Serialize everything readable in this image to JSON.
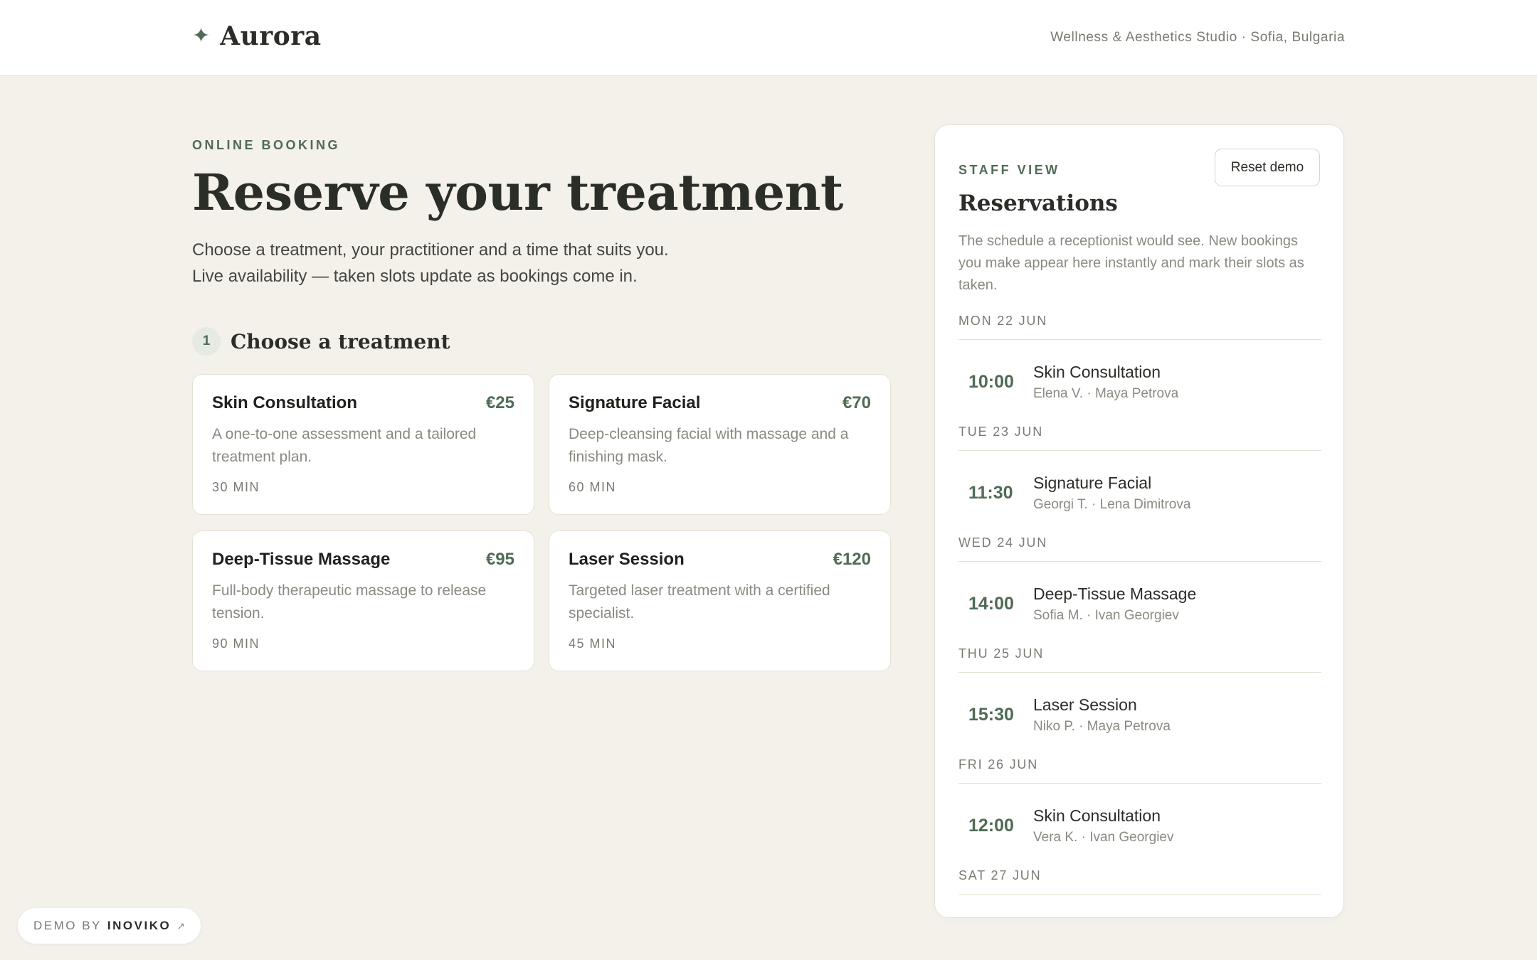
{
  "header": {
    "brand_icon": "✦",
    "brand_name": "Aurora",
    "tagline": "Wellness & Aesthetics Studio · Sofia, Bulgaria"
  },
  "hero": {
    "eyebrow": "ONLINE BOOKING",
    "title": "Reserve your treatment",
    "subtitle_line1": "Choose a treatment, your practitioner and a time that suits you.",
    "subtitle_line2": "Live availability — taken slots update as bookings come in."
  },
  "step": {
    "number": "1",
    "title": "Choose a treatment"
  },
  "treatments": [
    {
      "name": "Skin Consultation",
      "price": "€25",
      "description": "A one-to-one assessment and a tailored treatment plan.",
      "duration": "30 MIN"
    },
    {
      "name": "Signature Facial",
      "price": "€70",
      "description": "Deep-cleansing facial with massage and a finishing mask.",
      "duration": "60 MIN"
    },
    {
      "name": "Deep-Tissue Massage",
      "price": "€95",
      "description": "Full-body therapeutic massage to release tension.",
      "duration": "90 MIN"
    },
    {
      "name": "Laser Session",
      "price": "€120",
      "description": "Targeted laser treatment with a certified specialist.",
      "duration": "45 MIN"
    }
  ],
  "staff_panel": {
    "eyebrow": "STAFF VIEW",
    "reset_label": "Reset demo",
    "title": "Reservations",
    "description": "The schedule a receptionist would see. New bookings you make appear here instantly and mark their slots as taken.",
    "days": [
      {
        "label": "MON 22 JUN",
        "time": "10:00",
        "treatment": "Skin Consultation",
        "who": "Elena V. · Maya Petrova"
      },
      {
        "label": "TUE 23 JUN",
        "time": "11:30",
        "treatment": "Signature Facial",
        "who": "Georgi T. · Lena Dimitrova"
      },
      {
        "label": "WED 24 JUN",
        "time": "14:00",
        "treatment": "Deep-Tissue Massage",
        "who": "Sofia M. · Ivan Georgiev"
      },
      {
        "label": "THU 25 JUN",
        "time": "15:30",
        "treatment": "Laser Session",
        "who": "Niko P. · Maya Petrova"
      },
      {
        "label": "FRI 26 JUN",
        "time": "12:00",
        "treatment": "Skin Consultation",
        "who": "Vera K. · Ivan Georgiev"
      },
      {
        "label": "SAT 27 JUN"
      }
    ]
  },
  "footer_badge": {
    "prefix": "DEMO BY",
    "brand": "INOVIKO",
    "arrow": "↗"
  },
  "colors": {
    "page_background": "#f4f1ea",
    "accent_green": "#4f6b55",
    "card_background": "#ffffff"
  },
  "icons": {
    "brand_icon": "sparkle-icon",
    "badge_arrow": "external-link-arrow-icon"
  }
}
